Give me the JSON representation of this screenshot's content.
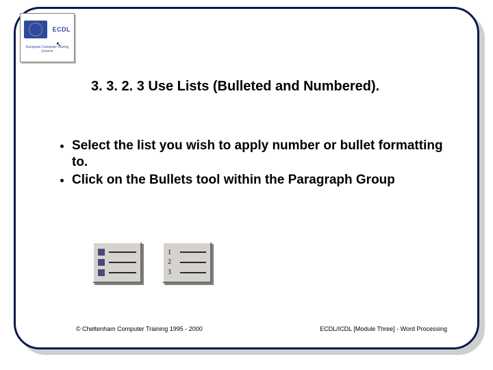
{
  "logo": {
    "brand": "ECDL",
    "subtext": "European Computer Driving Licence"
  },
  "title": "3. 3. 2. 3 Use Lists (Bulleted and Numbered).",
  "bullets": [
    {
      "text_a": "Select the list you wish to apply number or bullet formatting to."
    },
    {
      "text_a": "Click on the ",
      "strong": "Bullets",
      "text_b": " tool within the Paragraph Group"
    }
  ],
  "icons": {
    "bullets_tool": "bullets-list-icon",
    "numbers_tool": "numbered-list-icon",
    "num1": "1",
    "num2": "2",
    "num3": "3"
  },
  "footer": {
    "left": "© Cheltenham Computer Training 1995 - 2000",
    "right": "ECDL/ICDL [Module Three]  - Word Processing"
  }
}
